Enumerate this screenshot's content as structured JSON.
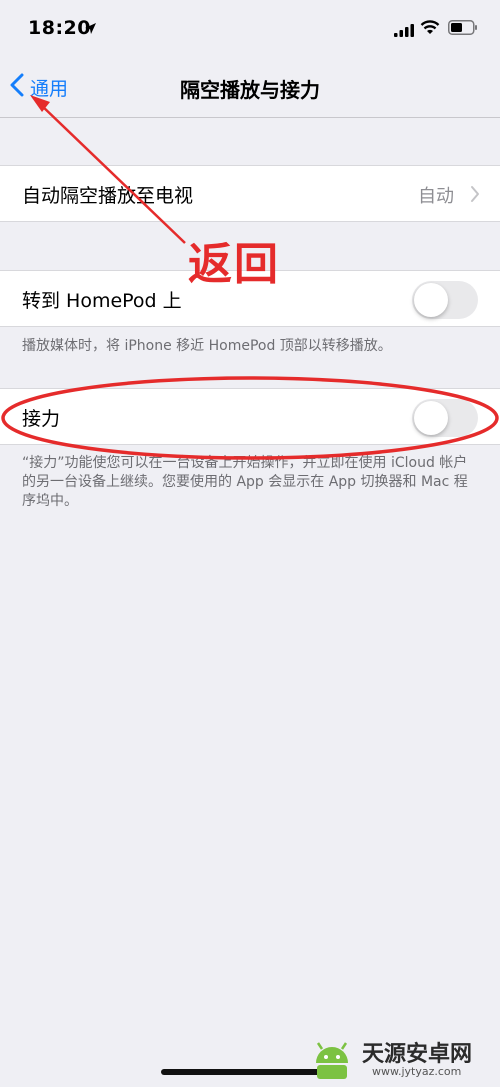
{
  "status_bar": {
    "time": "18:20"
  },
  "nav": {
    "back_label": "通用",
    "title": "隔空播放与接力"
  },
  "airplay_row": {
    "label": "自动隔空播放至电视",
    "value": "自动"
  },
  "homepod_row": {
    "label": "转到 HomePod 上",
    "toggle_on": false
  },
  "homepod_footer": "播放媒体时，将 iPhone 移近 HomePod 顶部以转移播放。",
  "handoff_row": {
    "label": "接力",
    "toggle_on": false
  },
  "handoff_footer": "“接力”功能使您可以在一台设备上开始操作，并立即在使用 iCloud 帐户的另一台设备上继续。您要使用的 App 会显示在 App 切换器和 Mac 程序坞中。",
  "annotation": {
    "label": "返回",
    "color": "#e52b2b"
  },
  "watermark": {
    "title": "天源安卓网",
    "url": "www.jytyaz.com"
  },
  "colors": {
    "accent": "#157efb",
    "background": "#efeff4"
  }
}
